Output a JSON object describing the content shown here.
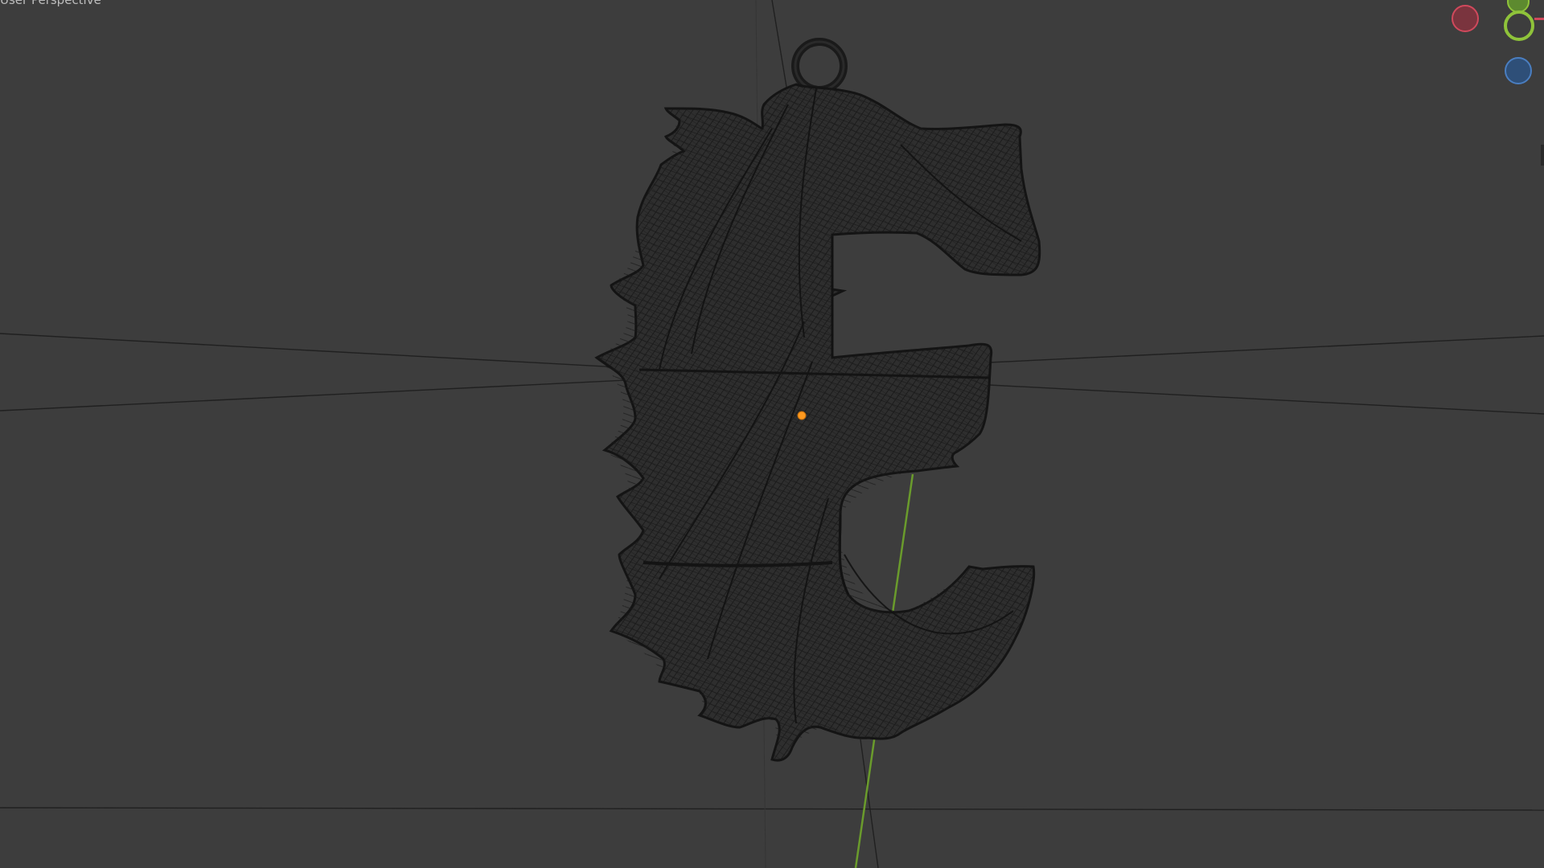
{
  "viewport": {
    "label": "User Perspective",
    "background": "#3d3d3d"
  },
  "gizmo": {
    "x_axis_color": "#d0495c",
    "y_axis_color": "#8fc33a",
    "z_axis_color": "#4a7ec0",
    "icons": [
      "x-axis-negative-icon",
      "y-axis-positive-icon",
      "z-axis-negative-icon"
    ]
  },
  "object": {
    "type": "wireframe-mesh",
    "shape": "ornate letter E pendant",
    "mesh_color": "#1c1c1c",
    "origin_color": "#ff9a1f"
  }
}
